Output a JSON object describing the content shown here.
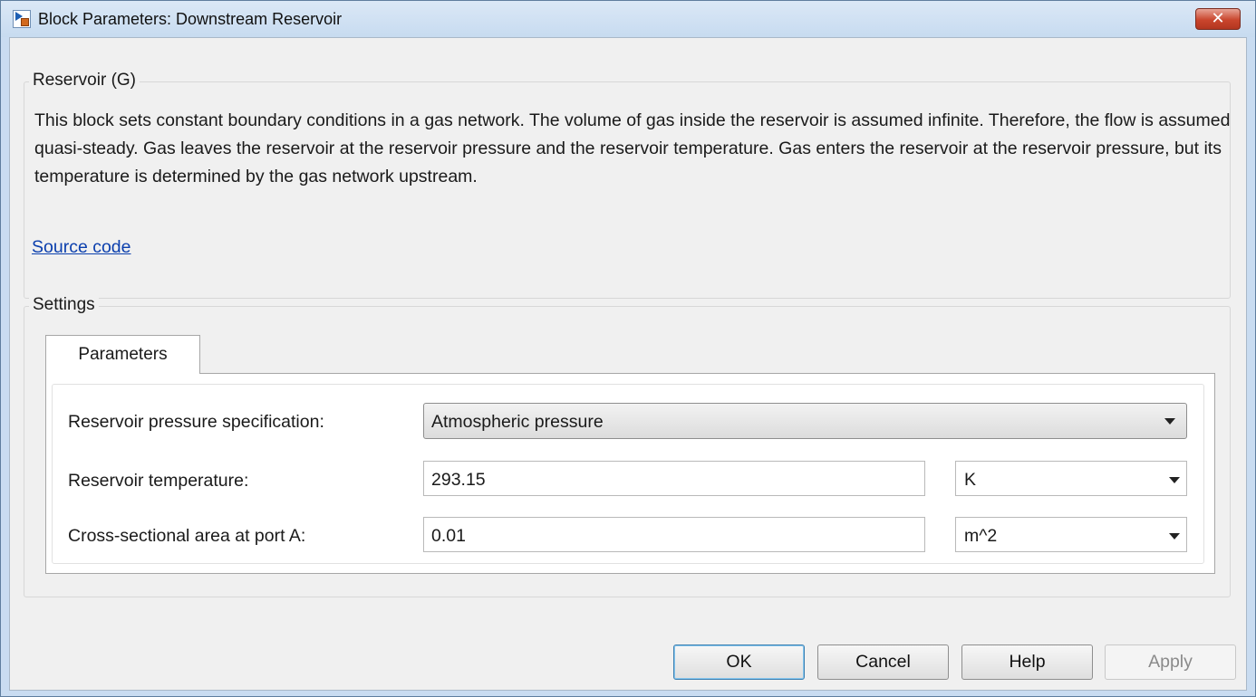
{
  "window": {
    "title": "Block Parameters: Downstream Reservoir",
    "close_glyph": "✕"
  },
  "reservoir": {
    "group_title": "Reservoir (G)",
    "description": "This block sets constant boundary conditions in a gas network. The volume of gas inside the reservoir is assumed infinite. Therefore, the flow is assumed quasi-steady. Gas leaves the reservoir at the reservoir pressure and the reservoir temperature. Gas enters the reservoir at the reservoir pressure, but its temperature is determined by the gas network upstream.",
    "link_label": "Source code"
  },
  "settings": {
    "group_title": "Settings",
    "tab_label": "Parameters",
    "pressure_spec": {
      "label": "Reservoir pressure specification:",
      "value": "Atmospheric pressure"
    },
    "temperature": {
      "label": "Reservoir temperature:",
      "value": "293.15",
      "unit": "K"
    },
    "area": {
      "label": "Cross-sectional area at port A:",
      "value": "0.01",
      "unit": "m^2"
    }
  },
  "buttons": {
    "ok": "OK",
    "cancel": "Cancel",
    "help": "Help",
    "apply": "Apply"
  },
  "icons": {
    "app": "simulink-block-icon",
    "close": "close-icon",
    "dropdown": "chevron-down-icon"
  },
  "colors": {
    "title_bar": "#c7dbf0",
    "close_button": "#c9452d",
    "link": "#0b3fad",
    "dialog_background": "#f0f0f0"
  }
}
